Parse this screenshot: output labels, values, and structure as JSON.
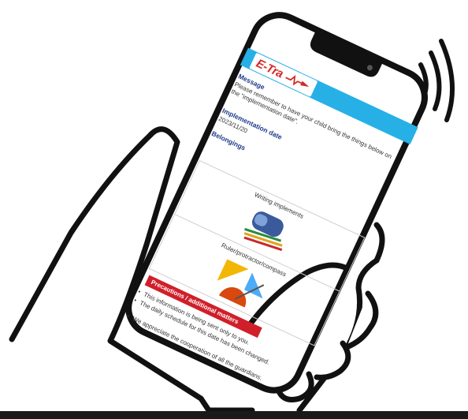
{
  "screen": {
    "logo_text": "E-Tra",
    "message_heading": "Message",
    "message_body": "Please remember to have your child bring the things below on the \"implementation date\".",
    "implementation_heading": "Implementation date",
    "implementation_date": "2023/11/20",
    "belongings_heading": "Belongings",
    "items": [
      {
        "label": "Writing implements",
        "icon": "pencil-case-icon"
      },
      {
        "label": "Ruler/protractor/compass",
        "icon": "geometry-tools-icon"
      }
    ],
    "precautions_heading": "Precautions / additional matters",
    "precautions": [
      "This information is being sent only to you.",
      "The daily schedule for this date has been changed.",
      "We appreciate the cooperation of all the guardians."
    ]
  },
  "colors": {
    "banner": "#26b0e6",
    "logo_red": "#d62828",
    "heading_blue": "#1d3b8a",
    "precautions_red": "#d01f2a",
    "outline": "#111111"
  },
  "icons": [
    "hand-icon",
    "wireless-signal-icon",
    "smartphone-icon"
  ]
}
